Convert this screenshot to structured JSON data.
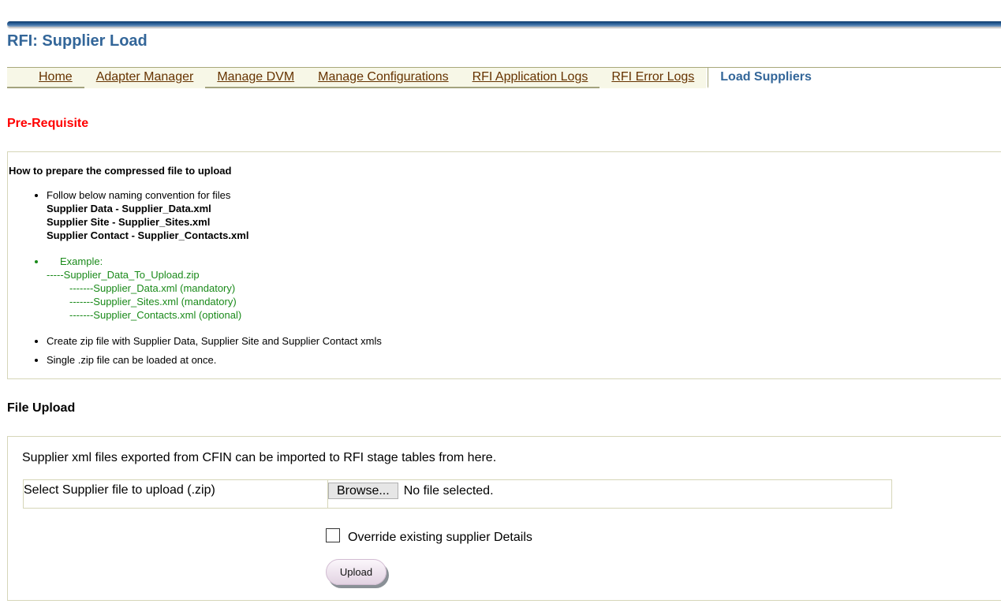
{
  "page": {
    "title": "RFI: Supplier Load"
  },
  "tabs": [
    {
      "label": "Home",
      "selected": false
    },
    {
      "label": "Adapter Manager",
      "selected": false
    },
    {
      "label": "Manage DVM",
      "selected": false
    },
    {
      "label": "Manage Configurations",
      "selected": false
    },
    {
      "label": "RFI Application Logs",
      "selected": false
    },
    {
      "label": "RFI Error Logs",
      "selected": false
    },
    {
      "label": "Load Suppliers",
      "selected": true
    }
  ],
  "prerequisite": {
    "heading": "Pre-Requisite",
    "subheading": "How to prepare the compressed file to upload",
    "naming_intro": "Follow below naming convention for files",
    "naming_rules": [
      "Supplier Data - Supplier_Data.xml",
      "Supplier Site - Supplier_Sites.xml",
      "Supplier Contact - Supplier_Contacts.xml"
    ],
    "example_label": "Example:",
    "example_zip": "-----Supplier_Data_To_Upload.zip",
    "example_files": [
      "-------Supplier_Data.xml (mandatory)",
      "-------Supplier_Sites.xml (mandatory)",
      "-------Supplier_Contacts.xml (optional)"
    ],
    "bullet_create_zip": "Create zip file with Supplier Data, Supplier Site and Supplier Contact xmls",
    "bullet_single_zip": "Single .zip file can be loaded at once."
  },
  "file_upload": {
    "heading": "File Upload",
    "description": "Supplier xml files exported from CFIN can be imported to RFI stage tables from here.",
    "select_label": "Select Supplier file to upload (.zip)",
    "browse_label": "Browse...",
    "file_status": "No file selected.",
    "override_label": "Override existing supplier Details",
    "override_checked": false,
    "upload_label": "Upload"
  },
  "colors": {
    "title_blue": "#336699",
    "prereq_red": "#ff0000",
    "tab_link_brown": "#663300",
    "example_green": "#1a8a1a",
    "tab_bg": "#f7f7e7",
    "border_olive": "#d6d6b8"
  }
}
